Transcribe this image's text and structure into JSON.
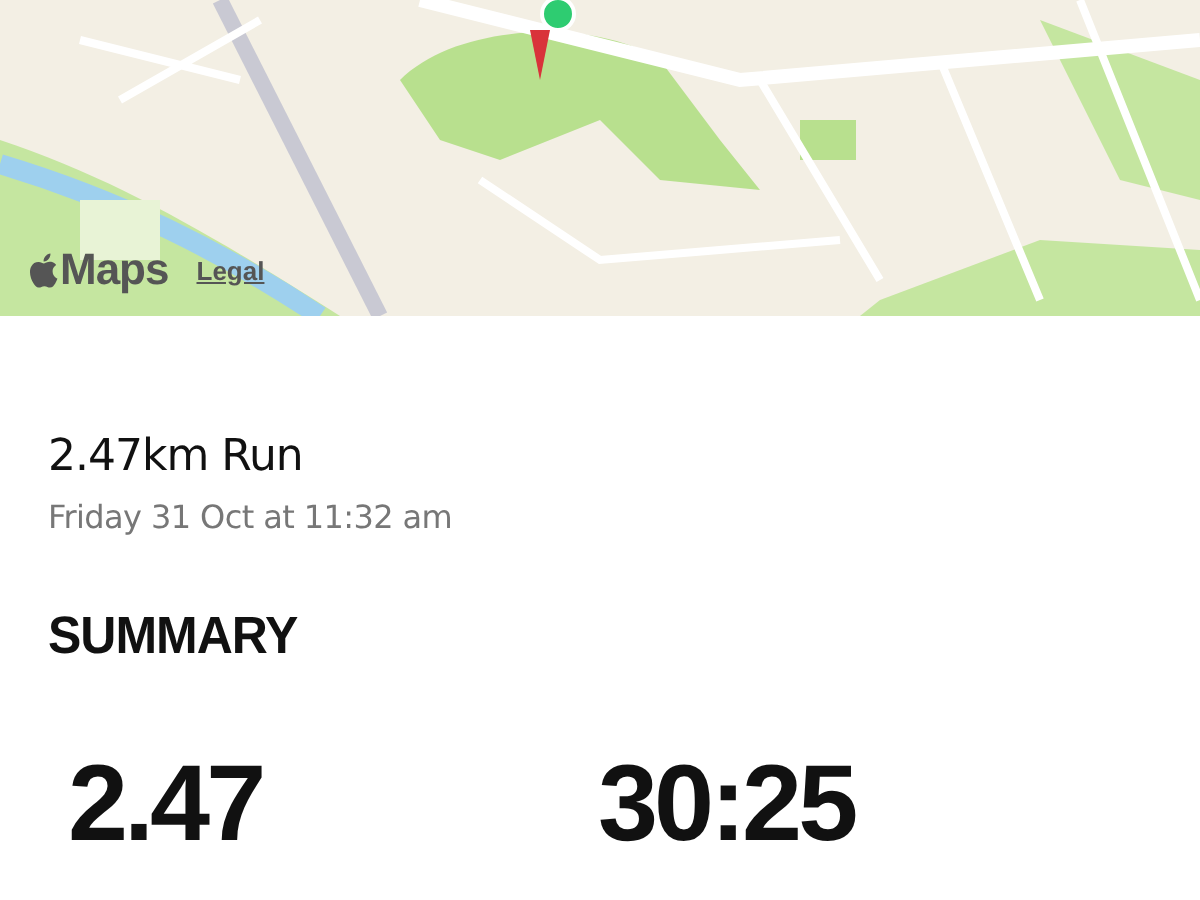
{
  "map": {
    "kind": "picture",
    "brand": "Maps",
    "legal_link": "Legal"
  },
  "activity": {
    "title": "2.47km Run",
    "date": "Friday 31 Oct at 11:32 am"
  },
  "summary": {
    "heading": "SUMMARY",
    "stats": [
      {
        "value": "2.47"
      },
      {
        "value": "30:25"
      }
    ]
  }
}
